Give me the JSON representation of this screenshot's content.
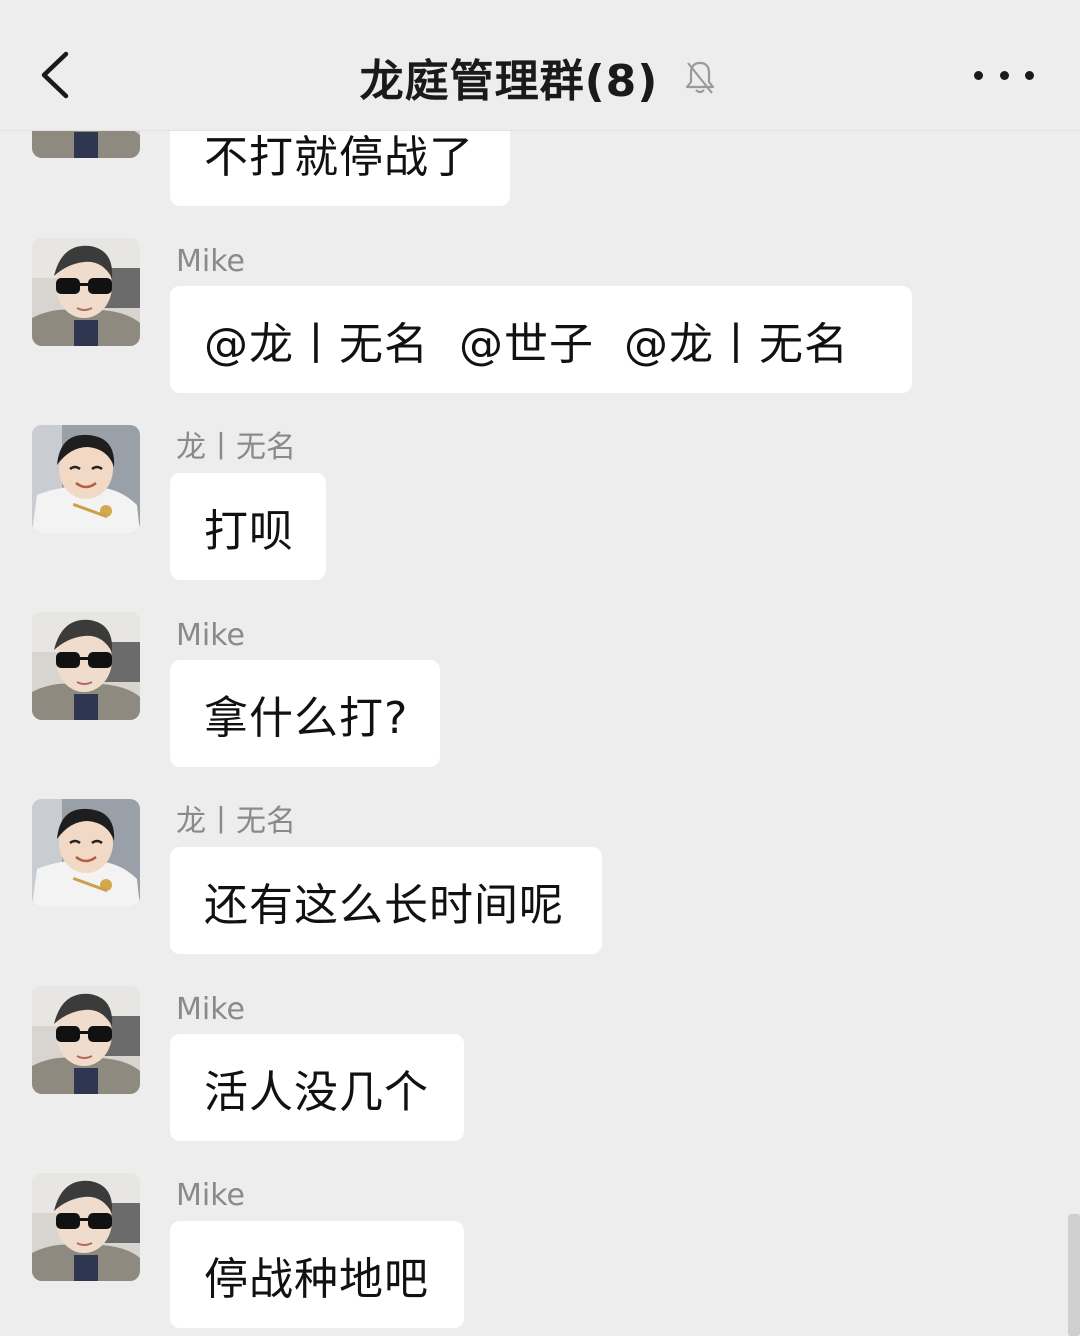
{
  "header": {
    "title": "龙庭管理群(8)",
    "back_icon": "chevron-left-icon",
    "mute_icon": "bell-off-icon",
    "more_icon": "more-horizontal-icon"
  },
  "messages": [
    {
      "sender": "",
      "avatar": "sunglasses-avatar",
      "text": "不打就停战了"
    },
    {
      "sender": "Mike",
      "avatar": "sunglasses-avatar",
      "text": "@龙丨无名  @世子  @龙丨无名"
    },
    {
      "sender": "龙丨无名",
      "avatar": "child-avatar",
      "text": "打呗"
    },
    {
      "sender": "Mike",
      "avatar": "sunglasses-avatar",
      "text": "拿什么打?"
    },
    {
      "sender": "龙丨无名",
      "avatar": "child-avatar",
      "text": "还有这么长时间呢"
    },
    {
      "sender": "Mike",
      "avatar": "sunglasses-avatar",
      "text": "活人没几个"
    },
    {
      "sender": "Mike",
      "avatar": "sunglasses-avatar",
      "text": "停战种地吧"
    }
  ],
  "colors": {
    "background": "#ededed",
    "bubble": "#ffffff",
    "sender_text": "#8a8a8a"
  }
}
